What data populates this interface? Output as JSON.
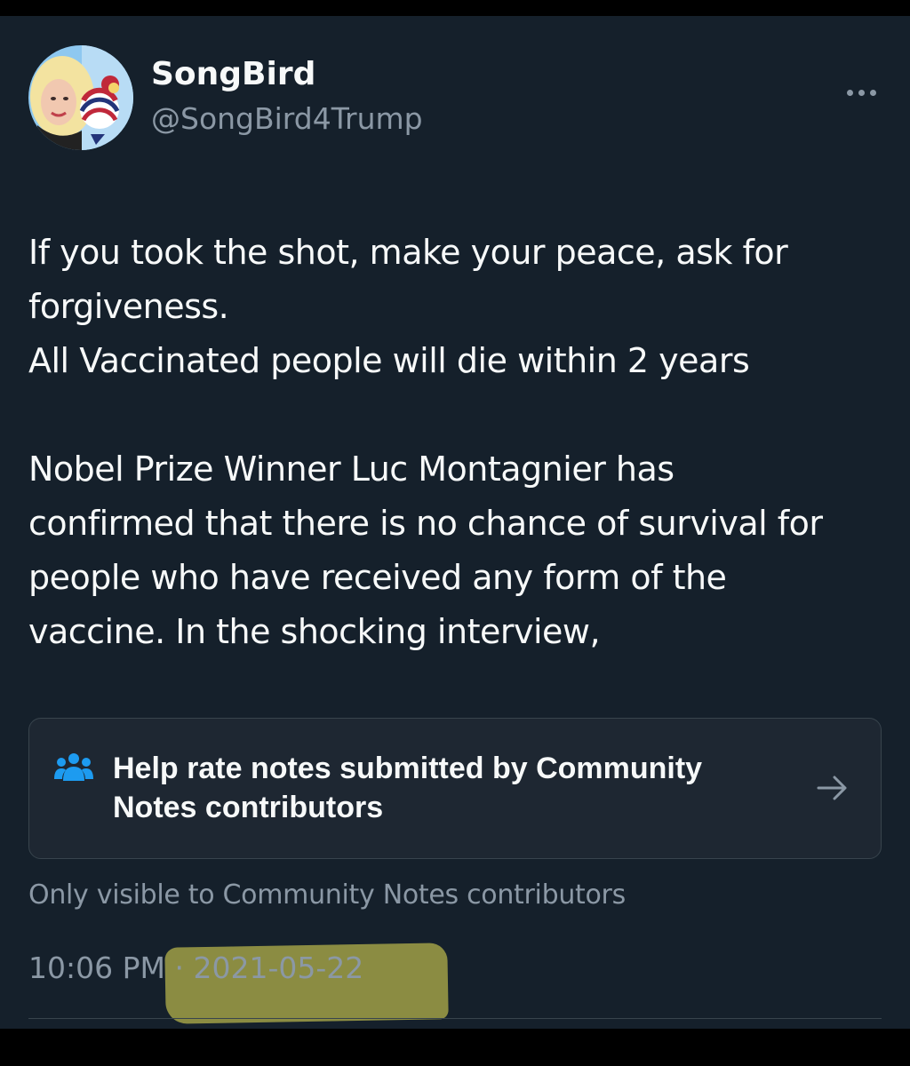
{
  "profile": {
    "display_name": "SongBird",
    "handle": "@SongBird4Trump",
    "avatar_icon": "profile-photo"
  },
  "tweet": {
    "lines": [
      "If you took the shot, make your peace, ask for",
      "forgiveness.",
      "All Vaccinated people will die within 2 years",
      "",
      "Nobel Prize Winner Luc Montagnier has",
      "confirmed that there is no chance of survival for",
      "people who have received any form of the",
      "vaccine. In the shocking interview,"
    ]
  },
  "community_notes": {
    "title_lines": [
      "Help rate notes submitted by Community",
      "Notes contributors"
    ],
    "icon": "people-icon",
    "arrow_icon": "arrow-right-icon",
    "icon_color": "#1d9bf0",
    "visibility_text": "Only visible to Community Notes contributors"
  },
  "meta": {
    "time": "10:06 PM",
    "separator": "·",
    "date": "2021-05-22"
  },
  "colors": {
    "background": "#15202b",
    "text": "#f7f9f9",
    "secondary_text": "#8b98a5",
    "highlight": "#a0a046"
  }
}
